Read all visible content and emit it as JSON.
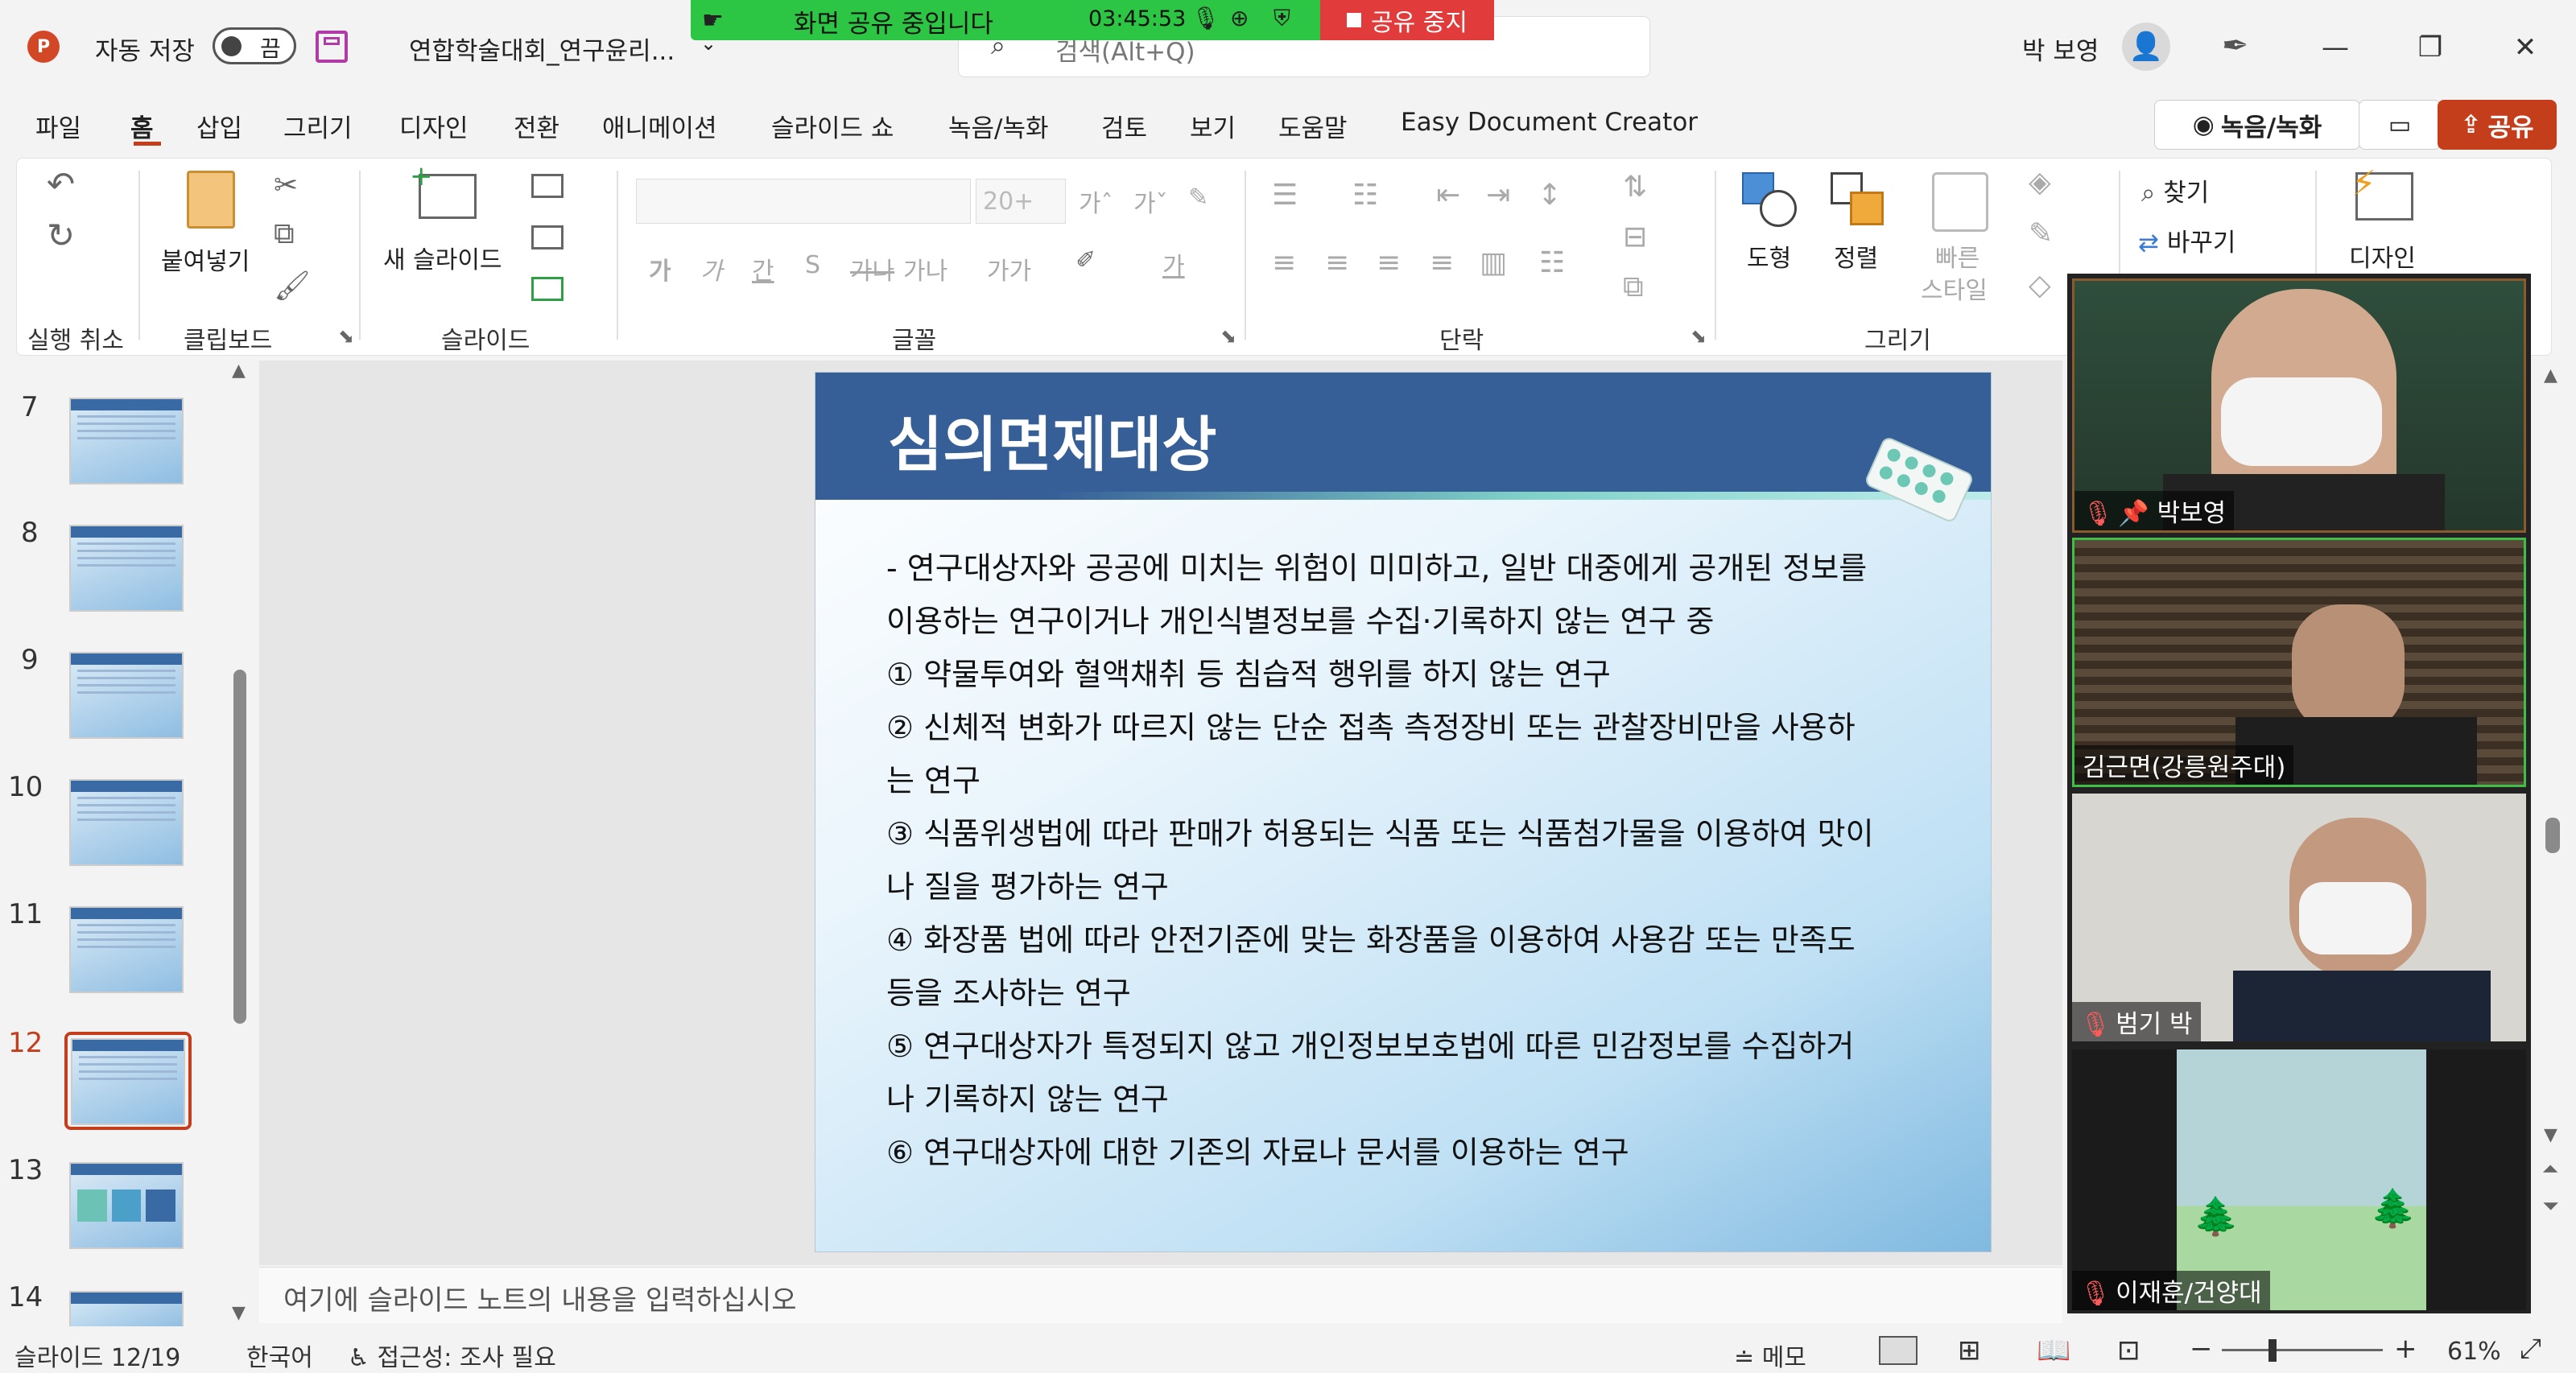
{
  "titlebar": {
    "autosave_label": "자동 저장",
    "autosave_state": "끔",
    "filename": "연합학술대회_연구윤리...",
    "search_placeholder": "검색(Alt+Q)",
    "user_name": "박 보영"
  },
  "share_banner": {
    "label": "화면 공유 중입니다",
    "time": "03:45:53",
    "stop_label": "공유 중지"
  },
  "menus": [
    "파일",
    "홈",
    "삽입",
    "그리기",
    "디자인",
    "전환",
    "애니메이션",
    "슬라이드 쇼",
    "녹음/녹화",
    "검토",
    "보기",
    "도움말",
    "Easy Document Creator"
  ],
  "menu_buttons": {
    "record": "녹음/녹화",
    "share": "공유"
  },
  "ribbon": {
    "undo_group": "실행 취소",
    "clipboard": {
      "paste": "붙여넣기",
      "group": "클립보드"
    },
    "slides": {
      "new_slide": "새 슬라이드",
      "group": "슬라이드"
    },
    "font": {
      "size": "20+",
      "group": "글꼴",
      "buttons": [
        "가",
        "가",
        "간",
        "S",
        "가나",
        "가나",
        "가가",
        "가",
        "가"
      ]
    },
    "paragraph": {
      "group": "단락"
    },
    "drawing": {
      "shape": "도형",
      "arrange": "정렬",
      "quick_style_1": "빠른",
      "quick_style_2": "스타일",
      "group": "그리기"
    },
    "editing": {
      "find": "찾기",
      "replace": "바꾸기"
    },
    "designer": "디자인"
  },
  "thumbnails": [
    "7",
    "8",
    "9",
    "10",
    "11",
    "12",
    "13",
    "14"
  ],
  "selected_thumbnail": "12",
  "slide": {
    "title": "심의면제대상",
    "lines": [
      "- 연구대상자와 공공에 미치는 위험이 미미하고, 일반 대중에게 공개된 정보를",
      "이용하는 연구이거나 개인식별정보를 수집·기록하지 않는 연구 중",
      "① 약물투여와 혈액채취 등 침습적 행위를 하지 않는 연구",
      "② 신체적 변화가 따르지 않는 단순 접촉 측정장비 또는 관찰장비만을 사용하",
      "는 연구",
      "③ 식품위생법에 따라 판매가 허용되는 식품 또는 식품첨가물을 이용하여 맛이",
      "나 질을 평가하는 연구",
      "④ 화장품 법에 따라 안전기준에 맞는 화장품을 이용하여 사용감 또는 만족도",
      "등을 조사하는 연구",
      "⑤ 연구대상자가 특정되지 않고 개인정보보호법에 따른 민감정보를 수집하거",
      "나 기록하지 않는 연구",
      "⑥ 연구대상자에 대한 기존의 자료나 문서를 이용하는 연구"
    ]
  },
  "notes_placeholder": "여기에 슬라이드 노트의 내용을 입력하십시오",
  "participants": [
    "박보영",
    "김근면(강릉원주대)",
    "범기 박",
    "이재훈/건양대"
  ],
  "status": {
    "slide": "슬라이드 12/19",
    "language": "한국어",
    "accessibility": "접근성: 조사 필요",
    "notes": "메모",
    "zoom": "61%"
  }
}
